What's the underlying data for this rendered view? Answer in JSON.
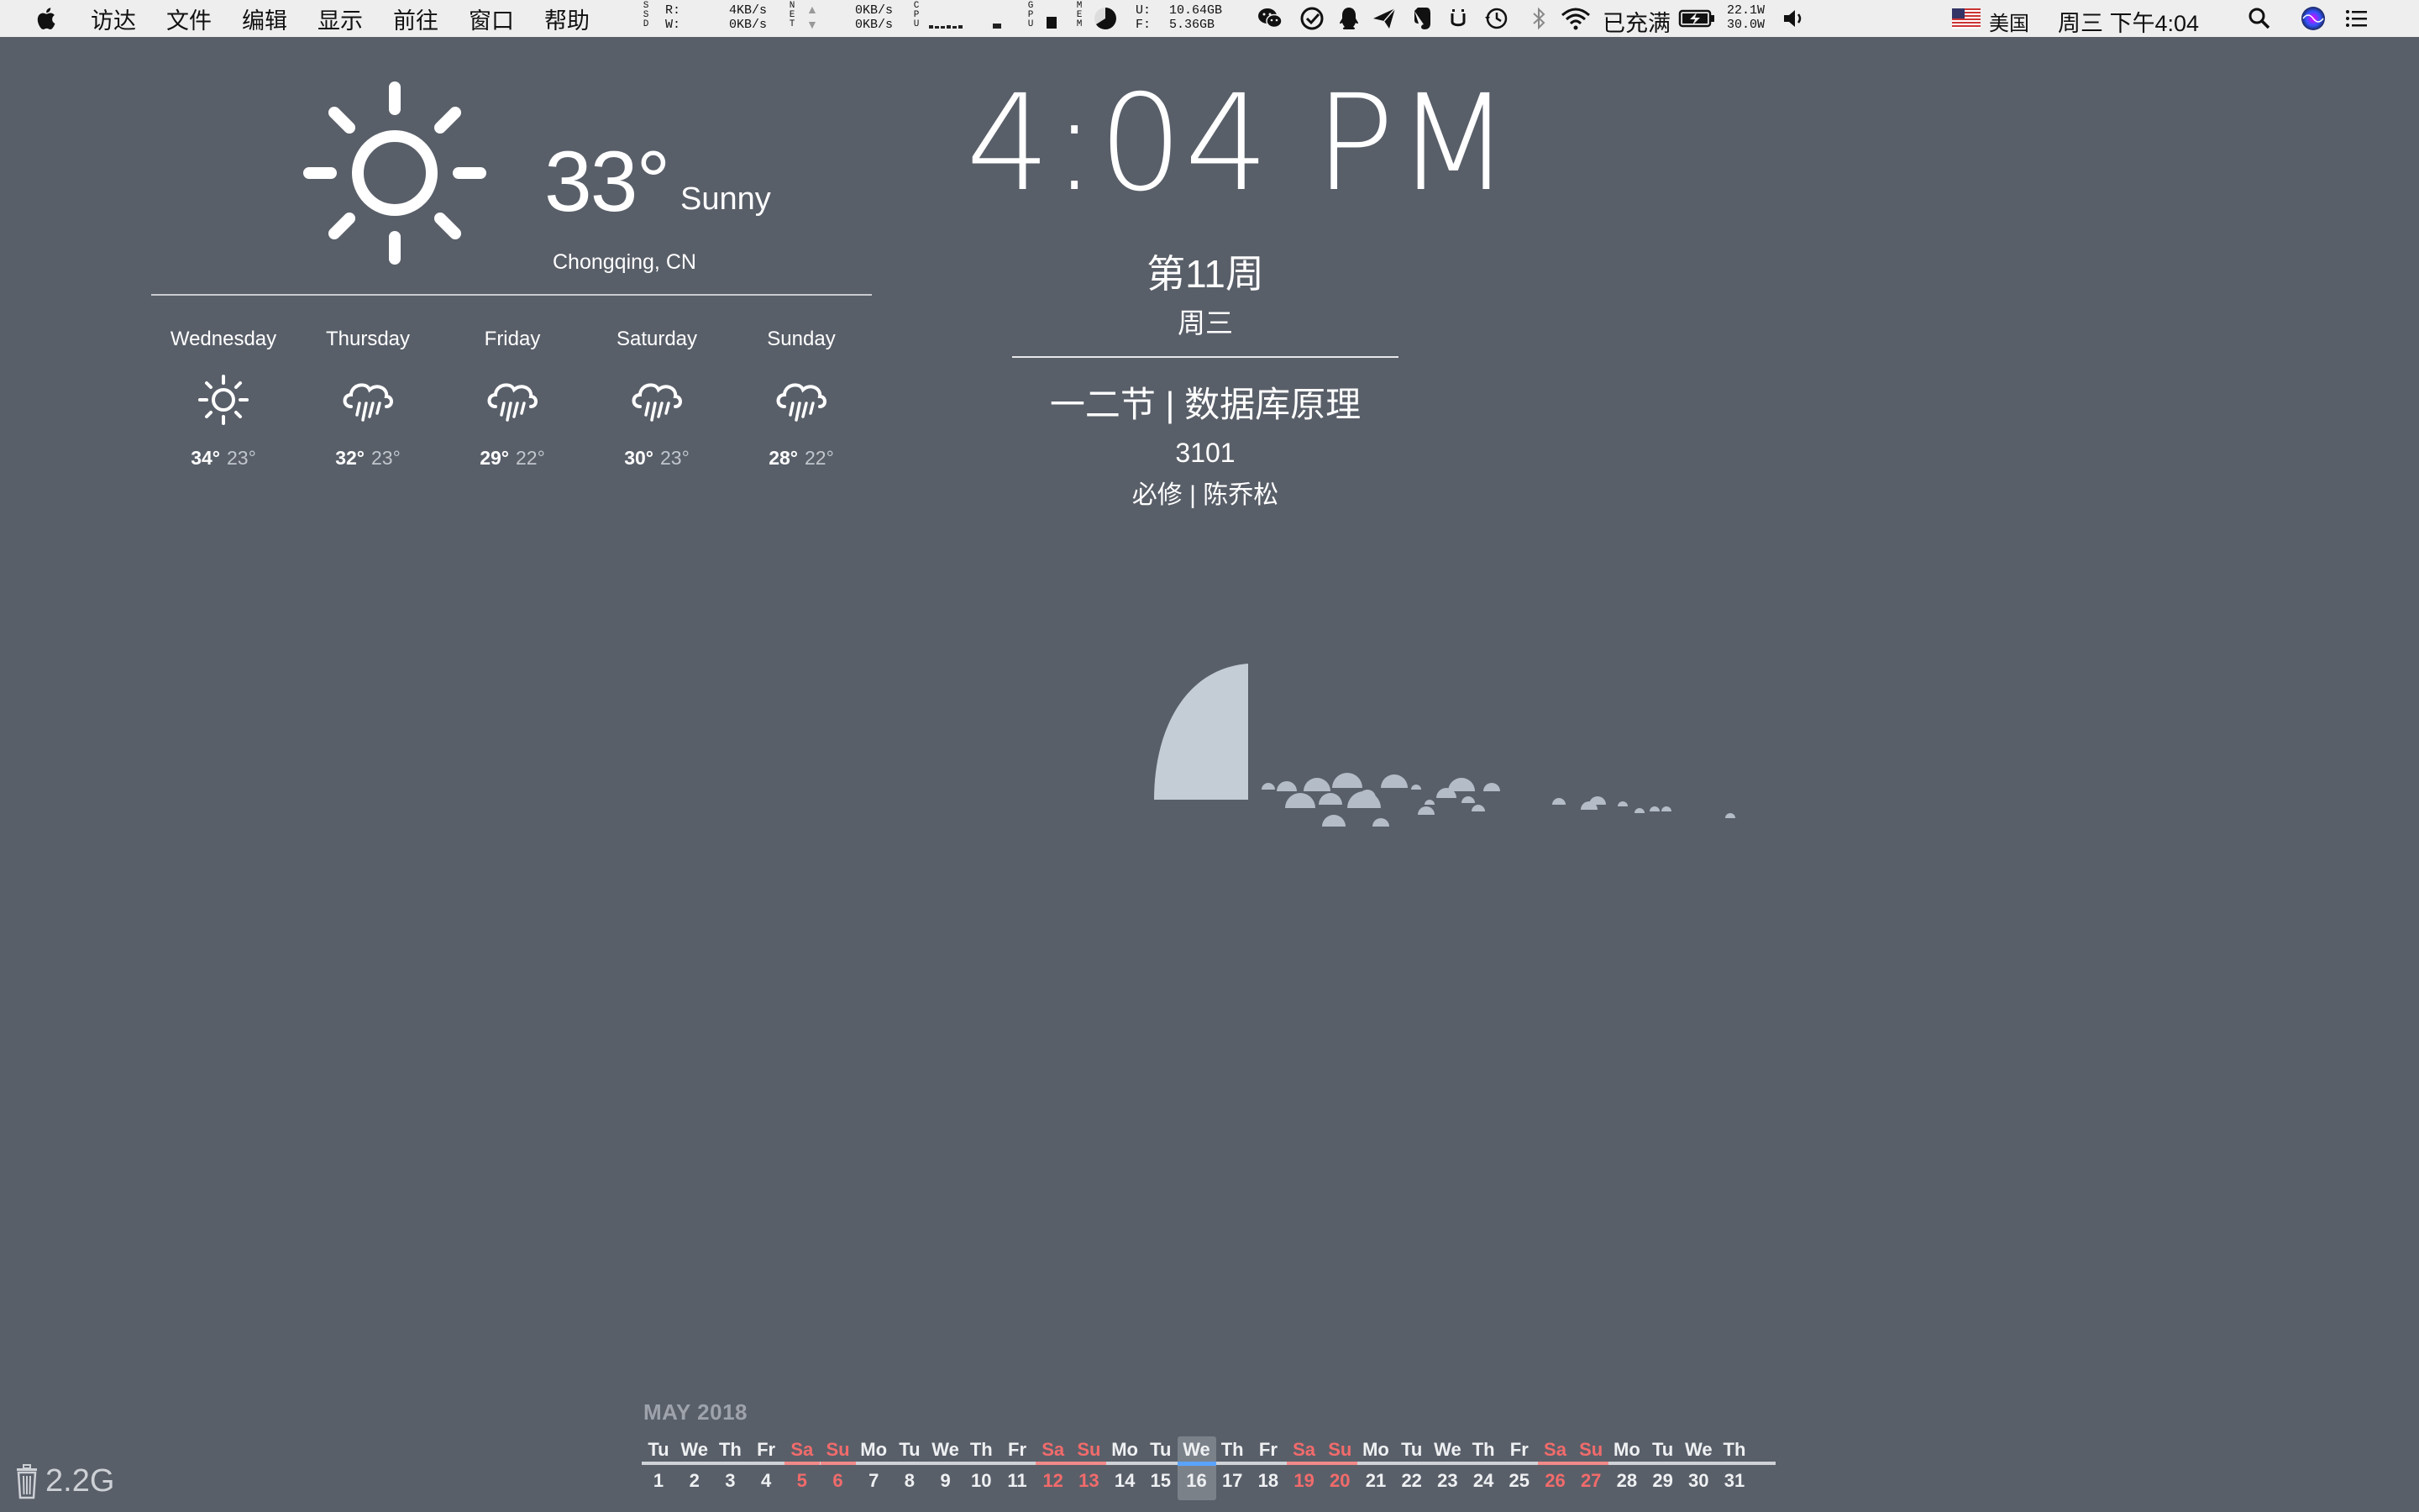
{
  "menubar": {
    "items": [
      "访达",
      "文件",
      "编辑",
      "显示",
      "前往",
      "窗口",
      "帮助"
    ],
    "ssd_label": "SSD",
    "disk_read_label": "R:",
    "disk_write_label": "W:",
    "net_label": "NET",
    "net_down": "4KB/s",
    "net_up": "0KB/s",
    "net2_down": "0KB/s",
    "net2_up": "0KB/s",
    "cpu_label": "CPU",
    "gpu_label": "GPU",
    "mem_label": "MEM",
    "mem_used_label": "U:",
    "mem_free_label": "F:",
    "mem_used": "10.64GB",
    "mem_free": "5.36GB",
    "battery_status": "已充满",
    "power_top": "22.1W",
    "power_bottom": "30.0W",
    "input_source": "美国",
    "datetime": "周三 下午4:04",
    "icons": [
      "apple-icon",
      "wechat-icon",
      "check-icon",
      "qq-icon",
      "send-icon",
      "evernote-icon",
      "u-icon",
      "time-machine-icon",
      "bluetooth-icon",
      "wifi-icon",
      "battery-icon",
      "volume-icon",
      "us-flag-icon",
      "search-icon",
      "siri-icon",
      "list-icon"
    ]
  },
  "weather": {
    "current_temp": "33°",
    "current_condition": "Sunny",
    "location": "Chongqing, CN",
    "current_icon": "sun-icon",
    "forecast": [
      {
        "day": "Wednesday",
        "icon": "sun-icon",
        "high": "34°",
        "low": "23°"
      },
      {
        "day": "Thursday",
        "icon": "rain-icon",
        "high": "32°",
        "low": "23°"
      },
      {
        "day": "Friday",
        "icon": "rain-icon",
        "high": "29°",
        "low": "22°"
      },
      {
        "day": "Saturday",
        "icon": "rain-icon",
        "high": "30°",
        "low": "23°"
      },
      {
        "day": "Sunday",
        "icon": "rain-icon",
        "high": "28°",
        "low": "22°"
      }
    ]
  },
  "clock": {
    "time": "4:04 PM",
    "week": "第11周",
    "weekday": "周三",
    "course": "一二节 | 数据库原理",
    "room": "3101",
    "course_meta": "必修 | 陈乔松"
  },
  "disk_chart": {
    "type": "radial-bubbles",
    "color": "#c4ccd6"
  },
  "calendar": {
    "month": "MAY 2018",
    "today": 16,
    "days": [
      {
        "wd": "Tu",
        "d": "1",
        "we": false
      },
      {
        "wd": "We",
        "d": "2",
        "we": false
      },
      {
        "wd": "Th",
        "d": "3",
        "we": false
      },
      {
        "wd": "Fr",
        "d": "4",
        "we": false
      },
      {
        "wd": "Sa",
        "d": "5",
        "we": true
      },
      {
        "wd": "Su",
        "d": "6",
        "we": true
      },
      {
        "wd": "Mo",
        "d": "7",
        "we": false
      },
      {
        "wd": "Tu",
        "d": "8",
        "we": false
      },
      {
        "wd": "We",
        "d": "9",
        "we": false
      },
      {
        "wd": "Th",
        "d": "10",
        "we": false
      },
      {
        "wd": "Fr",
        "d": "11",
        "we": false
      },
      {
        "wd": "Sa",
        "d": "12",
        "we": true
      },
      {
        "wd": "Su",
        "d": "13",
        "we": true
      },
      {
        "wd": "Mo",
        "d": "14",
        "we": false
      },
      {
        "wd": "Tu",
        "d": "15",
        "we": false
      },
      {
        "wd": "We",
        "d": "16",
        "we": false
      },
      {
        "wd": "Th",
        "d": "17",
        "we": false
      },
      {
        "wd": "Fr",
        "d": "18",
        "we": false
      },
      {
        "wd": "Sa",
        "d": "19",
        "we": true
      },
      {
        "wd": "Su",
        "d": "20",
        "we": true
      },
      {
        "wd": "Mo",
        "d": "21",
        "we": false
      },
      {
        "wd": "Tu",
        "d": "22",
        "we": false
      },
      {
        "wd": "We",
        "d": "23",
        "we": false
      },
      {
        "wd": "Th",
        "d": "24",
        "we": false
      },
      {
        "wd": "Fr",
        "d": "25",
        "we": false
      },
      {
        "wd": "Sa",
        "d": "26",
        "we": true
      },
      {
        "wd": "Su",
        "d": "27",
        "we": true
      },
      {
        "wd": "Mo",
        "d": "28",
        "we": false
      },
      {
        "wd": "Tu",
        "d": "29",
        "we": false
      },
      {
        "wd": "We",
        "d": "30",
        "we": false
      },
      {
        "wd": "Th",
        "d": "31",
        "we": false
      }
    ]
  },
  "trash": {
    "size": "2.2G"
  }
}
